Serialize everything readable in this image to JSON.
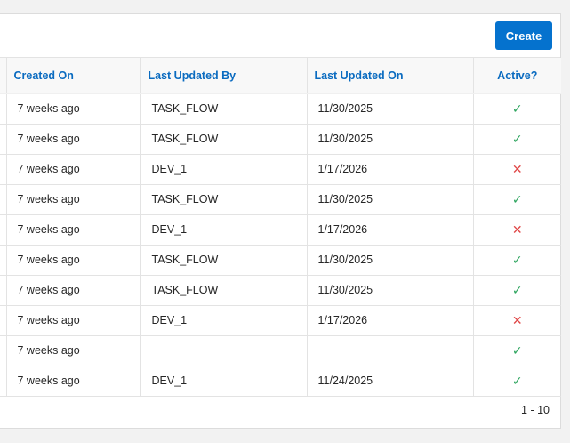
{
  "toolbar": {
    "create_label": "Create"
  },
  "table": {
    "headers": {
      "created_on": "Created On",
      "last_updated_by": "Last Updated By",
      "last_updated_on": "Last Updated On",
      "active": "Active?"
    },
    "rows": [
      {
        "created_on": "7 weeks ago",
        "last_updated_by": "TASK_FLOW",
        "last_updated_on": "11/30/2025",
        "active": true
      },
      {
        "created_on": "7 weeks ago",
        "last_updated_by": "TASK_FLOW",
        "last_updated_on": "11/30/2025",
        "active": true
      },
      {
        "created_on": "7 weeks ago",
        "last_updated_by": "DEV_1",
        "last_updated_on": "1/17/2026",
        "active": false
      },
      {
        "created_on": "7 weeks ago",
        "last_updated_by": "TASK_FLOW",
        "last_updated_on": "11/30/2025",
        "active": true
      },
      {
        "created_on": "7 weeks ago",
        "last_updated_by": "DEV_1",
        "last_updated_on": "1/17/2026",
        "active": false
      },
      {
        "created_on": "7 weeks ago",
        "last_updated_by": "TASK_FLOW",
        "last_updated_on": "11/30/2025",
        "active": true
      },
      {
        "created_on": "7 weeks ago",
        "last_updated_by": "TASK_FLOW",
        "last_updated_on": "11/30/2025",
        "active": true
      },
      {
        "created_on": "7 weeks ago",
        "last_updated_by": "DEV_1",
        "last_updated_on": "1/17/2026",
        "active": false
      },
      {
        "created_on": "7 weeks ago",
        "last_updated_by": "",
        "last_updated_on": "",
        "active": true
      },
      {
        "created_on": "7 weeks ago",
        "last_updated_by": "DEV_1",
        "last_updated_on": "11/24/2025",
        "active": true
      }
    ]
  },
  "icons": {
    "active_true": "check-icon",
    "active_false": "cross-icon"
  },
  "colors": {
    "accent": "#0572ce",
    "header_text": "#0a6bc0",
    "check": "#2ea55f",
    "cross": "#e04747"
  },
  "pagination": {
    "range": "1 - 10"
  }
}
